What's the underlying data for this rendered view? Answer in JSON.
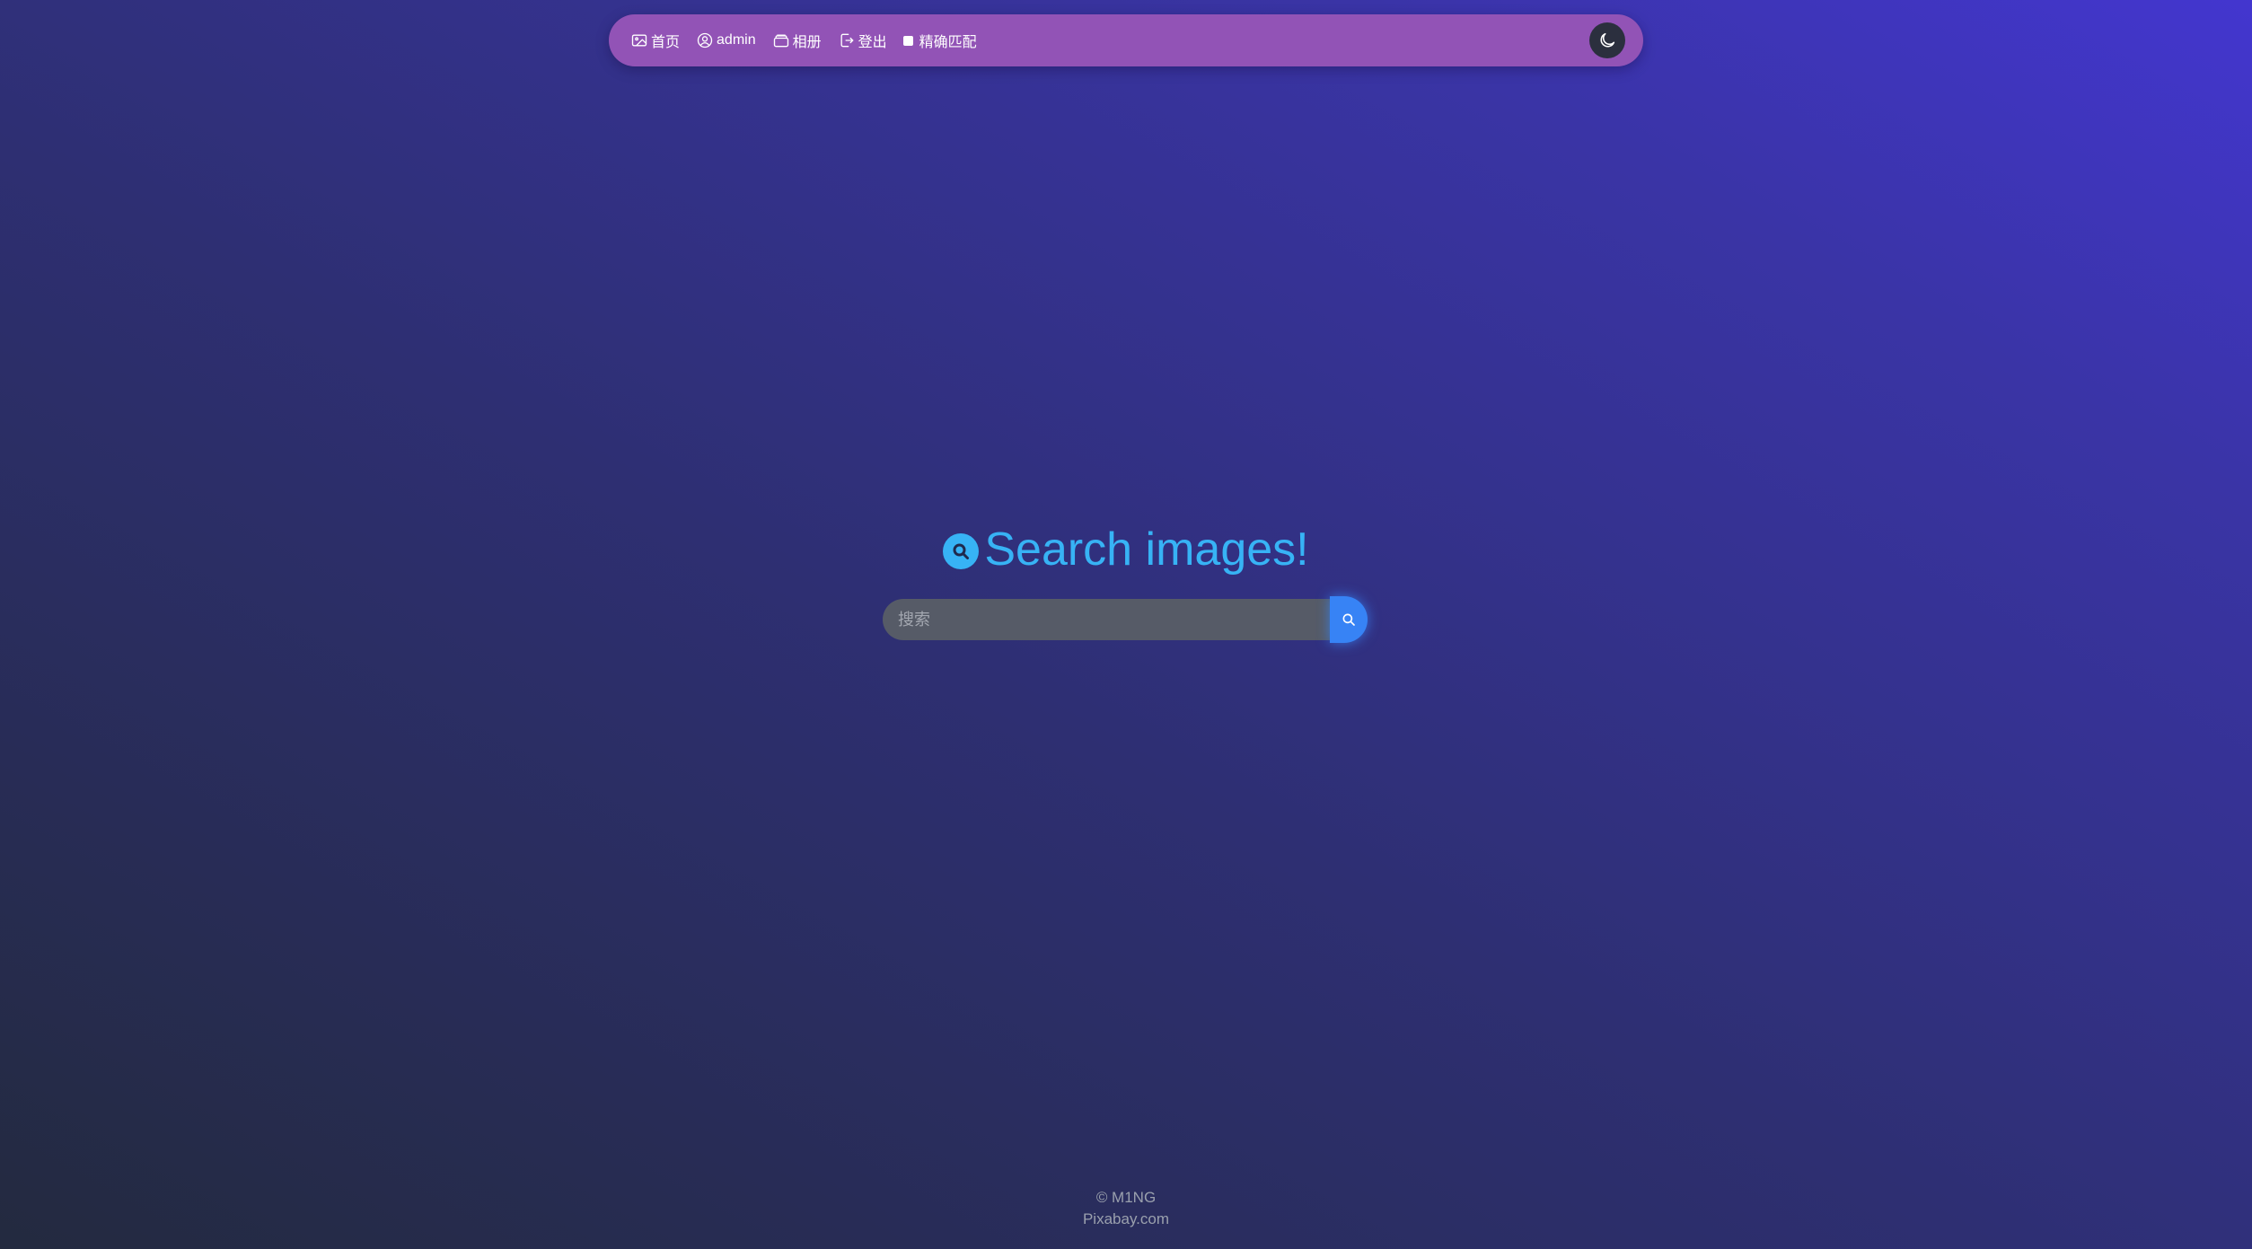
{
  "nav": {
    "items": [
      {
        "label": "首页",
        "icon": "image-icon"
      },
      {
        "label": "admin",
        "icon": "user-circle-icon"
      },
      {
        "label": "相册",
        "icon": "album-icon"
      },
      {
        "label": "登出",
        "icon": "logout-icon"
      }
    ],
    "exact_match_label": "精确匹配",
    "theme_toggle_icon": "moon-icon",
    "bar_color": "#9253b6"
  },
  "hero": {
    "title": "Search images!",
    "icon": "search-icon",
    "accent_color": "#37b3f5"
  },
  "search": {
    "placeholder": "搜索",
    "value": "",
    "button_icon": "search-icon",
    "button_color": "#3783f5"
  },
  "footer": {
    "copyright": "© M1NG",
    "credit": "Pixabay.com"
  }
}
